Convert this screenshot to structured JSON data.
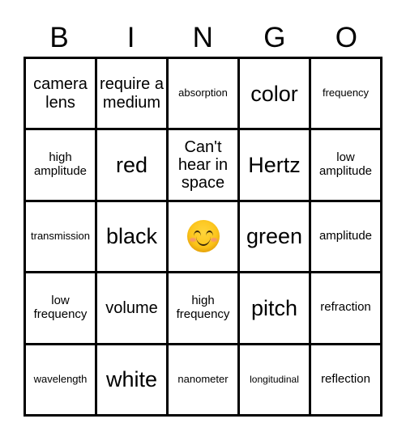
{
  "card": {
    "header_letters": [
      "B",
      "I",
      "N",
      "G",
      "O"
    ],
    "grid": {
      "rows": [
        [
          {
            "text": "camera lens",
            "size": "sz-l",
            "type": "text"
          },
          {
            "text": "require a medium",
            "size": "sz-l",
            "type": "text"
          },
          {
            "text": "absorption",
            "size": "sz-s",
            "type": "text"
          },
          {
            "text": "color",
            "size": "sz-xl",
            "type": "text"
          },
          {
            "text": "frequency",
            "size": "sz-s",
            "type": "text"
          }
        ],
        [
          {
            "text": "high amplitude",
            "size": "sz-m",
            "type": "text"
          },
          {
            "text": "red",
            "size": "sz-xl",
            "type": "text"
          },
          {
            "text": "Can't hear in space",
            "size": "sz-l",
            "type": "text"
          },
          {
            "text": "Hertz",
            "size": "sz-xl",
            "type": "text"
          },
          {
            "text": "low amplitude",
            "size": "sz-m",
            "type": "text"
          }
        ],
        [
          {
            "text": "transmission",
            "size": "sz-s",
            "type": "text"
          },
          {
            "text": "black",
            "size": "sz-xl",
            "type": "text"
          },
          {
            "text": "😊",
            "size": "free-space",
            "type": "emoji",
            "icon": "smiling-face-with-smiling-eyes"
          },
          {
            "text": "green",
            "size": "sz-xl",
            "type": "text"
          },
          {
            "text": "amplitude",
            "size": "sz-m",
            "type": "text"
          }
        ],
        [
          {
            "text": "low frequency",
            "size": "sz-m",
            "type": "text"
          },
          {
            "text": "volume",
            "size": "sz-l",
            "type": "text"
          },
          {
            "text": "high frequency",
            "size": "sz-m",
            "type": "text"
          },
          {
            "text": "pitch",
            "size": "sz-xl",
            "type": "text"
          },
          {
            "text": "refraction",
            "size": "sz-m",
            "type": "text"
          }
        ],
        [
          {
            "text": "wavelength",
            "size": "sz-s",
            "type": "text"
          },
          {
            "text": "white",
            "size": "sz-xl",
            "type": "text"
          },
          {
            "text": "nanometer",
            "size": "sz-s",
            "type": "text"
          },
          {
            "text": "longitudinal",
            "size": "sz-xs",
            "type": "text"
          },
          {
            "text": "reflection",
            "size": "sz-m",
            "type": "text"
          }
        ]
      ]
    },
    "colors": {
      "background": "#ffffff",
      "grid_line": "#000000",
      "text": "#000000",
      "emoji_face": "#fcc419",
      "emoji_feature": "#3b2a0a",
      "emoji_cheek": "#f48782"
    }
  }
}
